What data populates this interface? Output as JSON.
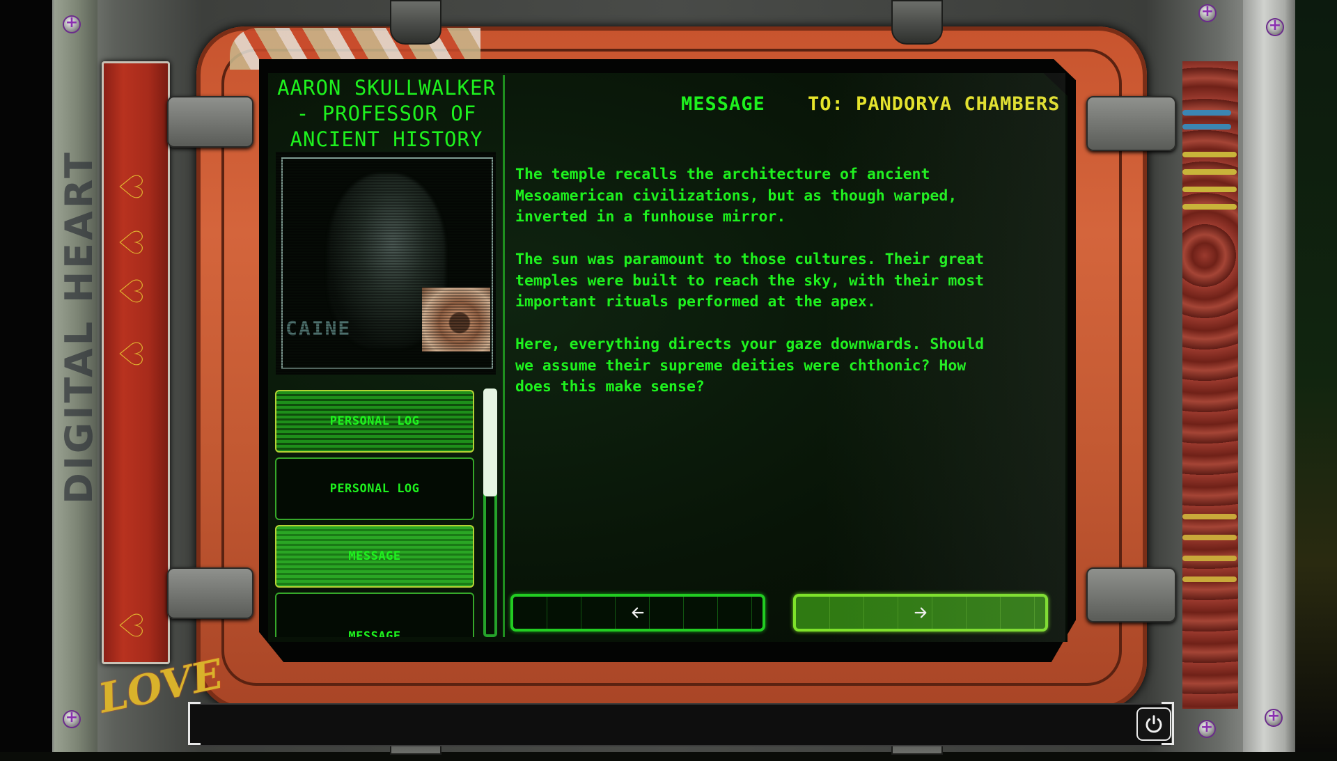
{
  "contact": {
    "name": "AARON SKULLWALKER - PROFESSOR OF ANCIENT HISTORY",
    "portrait_label": "CAINE"
  },
  "log_list": {
    "items": [
      {
        "label": "PERSONAL LOG",
        "state": "selected-highlight"
      },
      {
        "label": "PERSONAL LOG",
        "state": "default"
      },
      {
        "label": "MESSAGE",
        "state": "active"
      },
      {
        "label": "MESSAGE",
        "state": "default"
      }
    ],
    "scroll_position": 0.0,
    "visible_fraction": 0.43
  },
  "message": {
    "type_label": "MESSAGE",
    "to_label": "TO: PANDORYA CHAMBERS",
    "paragraphs": [
      "The temple recalls the architecture of ancient\nMesoamerican civilizations, but as though warped,\ninverted in a funhouse mirror.",
      "The sun was paramount to those cultures. Their great\ntemples were built to reach the sky, with their most\nimportant rituals performed at the apex.",
      "Here, everything directs your gaze downwards. Should\nwe assume their supreme deities were chthonic? How\ndoes this make sense?"
    ]
  },
  "navigation": {
    "prev_icon": "arrow-left-icon",
    "next_icon": "arrow-right-icon"
  },
  "bottom_bar": {
    "power_icon": "power-icon"
  },
  "decor": {
    "left_rail_text": "DIGITAL HEART",
    "graffiti": "LOVE",
    "colors": {
      "terminal_green": "#1ef21e",
      "recipient_yellow": "#e6e42a",
      "frame_orange": "#c8542e"
    }
  }
}
